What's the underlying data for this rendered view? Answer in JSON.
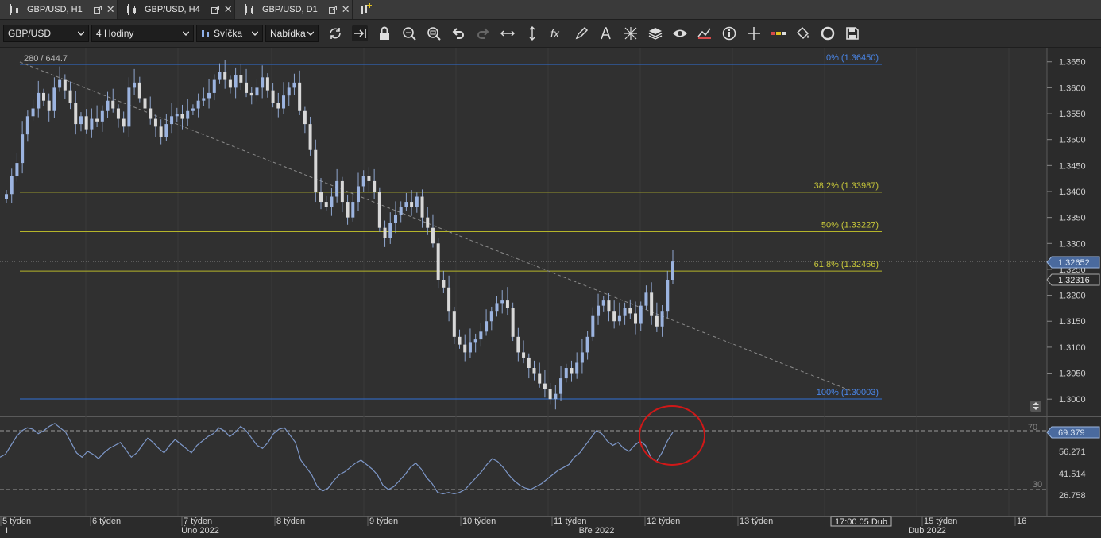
{
  "tabs": [
    {
      "label": "GBP/USD, H1",
      "active": false
    },
    {
      "label": "GBP/USD, H4",
      "active": true
    },
    {
      "label": "GBP/USD, D1",
      "active": false
    }
  ],
  "toolbar": {
    "symbol": "GBP/USD",
    "timeframe": "4 Hodiny",
    "chart_type": "Svíčka",
    "menu": "Nabídka"
  },
  "chart": {
    "crosshair_readout": "280 / 644.7",
    "fibonacci": [
      {
        "label": "0% (1.36450)",
        "level": 1.3645,
        "color": "#2f6fd6"
      },
      {
        "label": "38.2% (1.33987)",
        "level": 1.33987,
        "color": "#b5b52a"
      },
      {
        "label": "50% (1.33227)",
        "level": 1.33227,
        "color": "#b5b52a"
      },
      {
        "label": "61.8% (1.32466)",
        "level": 1.32466,
        "color": "#b5b52a"
      },
      {
        "label": "100% (1.30003)",
        "level": 1.30003,
        "color": "#2f6fd6"
      }
    ],
    "price_axis": [
      "1.3650",
      "1.3600",
      "1.3550",
      "1.3500",
      "1.3450",
      "1.3400",
      "1.3350",
      "1.3300",
      "1.3250",
      "1.3200",
      "1.3150",
      "1.3100",
      "1.3050",
      "1.3000"
    ],
    "current_price": "1.32652",
    "bid_price": "1.32316",
    "rsi": {
      "levels": [
        "70",
        "30"
      ],
      "axis": [
        "56.271",
        "41.514",
        "26.758"
      ],
      "current": "69.379"
    },
    "time_axis": {
      "weeks": [
        "5 týden",
        "6 týden",
        "7 týden",
        "8 týden",
        "9 týden",
        "10 týden",
        "11 týden",
        "12 týden",
        "13 týden",
        "15 týden",
        "16"
      ],
      "cursor_time": "17:00 05 Dub",
      "months": [
        "Úno 2022",
        "Bře 2022",
        "Dub 2022"
      ],
      "edge_marker": "I"
    }
  },
  "chart_data": {
    "type": "candlestick",
    "title": "",
    "xlabel": "",
    "ylabel": "",
    "ylim": [
      1.2985,
      1.3665
    ],
    "closes": [
      1.3395,
      1.343,
      1.3455,
      1.351,
      1.3545,
      1.356,
      1.359,
      1.3575,
      1.3555,
      1.36,
      1.3615,
      1.3595,
      1.357,
      1.353,
      1.3545,
      1.352,
      1.354,
      1.3535,
      1.3555,
      1.3575,
      1.356,
      1.354,
      1.3525,
      1.36,
      1.361,
      1.358,
      1.356,
      1.354,
      1.3525,
      1.3505,
      1.353,
      1.3545,
      1.355,
      1.354,
      1.3555,
      1.356,
      1.3575,
      1.358,
      1.359,
      1.3615,
      1.363,
      1.3615,
      1.36,
      1.3625,
      1.361,
      1.359,
      1.3585,
      1.36,
      1.362,
      1.3595,
      1.357,
      1.356,
      1.3585,
      1.36,
      1.361,
      1.3555,
      1.353,
      1.348,
      1.34,
      1.338,
      1.337,
      1.339,
      1.342,
      1.338,
      1.335,
      1.338,
      1.341,
      1.343,
      1.342,
      1.34,
      1.333,
      1.331,
      1.334,
      1.3355,
      1.337,
      1.338,
      1.337,
      1.339,
      1.335,
      1.333,
      1.33,
      1.323,
      1.3215,
      1.317,
      1.312,
      1.3105,
      1.309,
      1.311,
      1.3115,
      1.313,
      1.315,
      1.317,
      1.3185,
      1.319,
      1.3175,
      1.312,
      1.309,
      1.308,
      1.306,
      1.305,
      1.303,
      1.302,
      1.3,
      1.301,
      1.304,
      1.306,
      1.305,
      1.307,
      1.309,
      1.312,
      1.316,
      1.318,
      1.319,
      1.317,
      1.315,
      1.316,
      1.3175,
      1.3165,
      1.3145,
      1.318,
      1.3205,
      1.316,
      1.314,
      1.317,
      1.323,
      1.3265
    ],
    "rsi_values": [
      52,
      54,
      60,
      66,
      70,
      72,
      71,
      68,
      70,
      73,
      75,
      72,
      69,
      62,
      55,
      52,
      56,
      54,
      51,
      55,
      58,
      60,
      62,
      57,
      52,
      55,
      60,
      65,
      62,
      58,
      55,
      60,
      64,
      61,
      58,
      55,
      60,
      63,
      66,
      68,
      72,
      70,
      66,
      69,
      73,
      70,
      65,
      60,
      58,
      62,
      68,
      71,
      72,
      67,
      62,
      50,
      45,
      40,
      32,
      29,
      31,
      36,
      40,
      42,
      45,
      48,
      50,
      47,
      44,
      40,
      33,
      30,
      32,
      36,
      40,
      45,
      48,
      44,
      38,
      34,
      28,
      27,
      28,
      27,
      28,
      30,
      34,
      38,
      42,
      47,
      51,
      49,
      45,
      40,
      36,
      33,
      31,
      30,
      32,
      34,
      37,
      40,
      43,
      45,
      47,
      52,
      55,
      60,
      65,
      70,
      68,
      63,
      60,
      62,
      58,
      56,
      60,
      63,
      60,
      52,
      49,
      55,
      63,
      69
    ]
  }
}
